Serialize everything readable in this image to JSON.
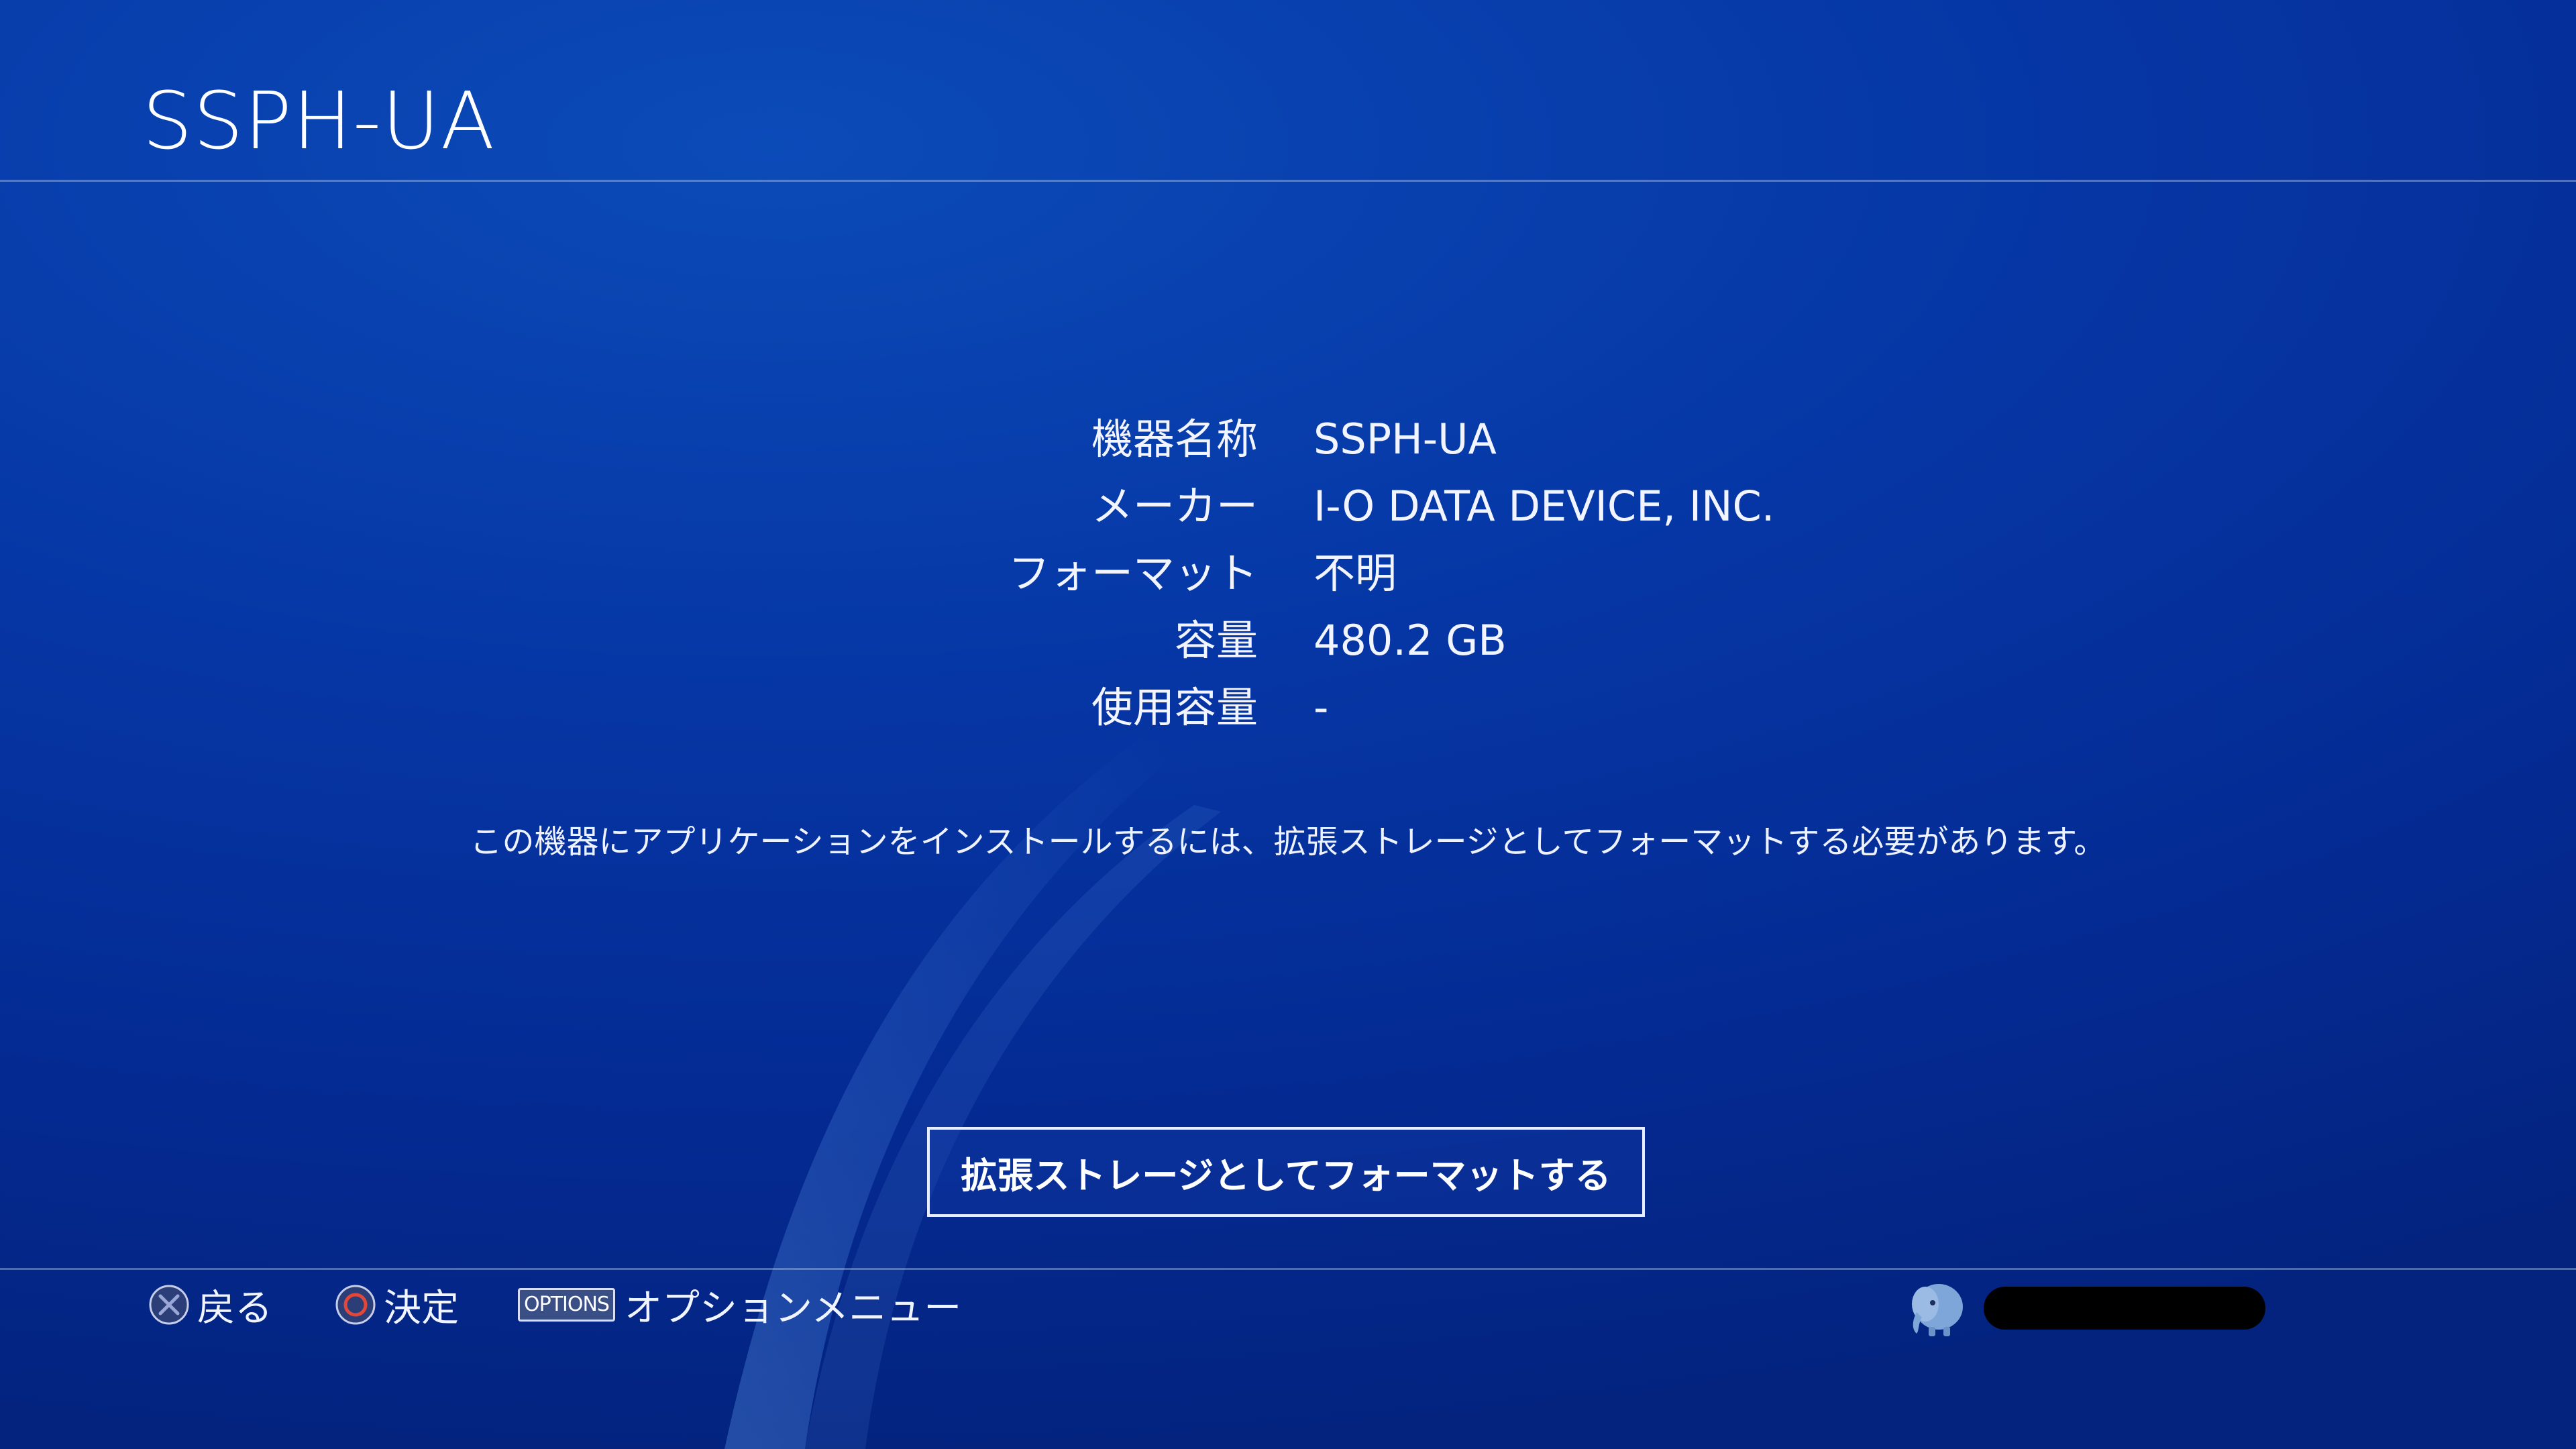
{
  "header": {
    "title": "SSPH-UA"
  },
  "device_info": {
    "rows": [
      {
        "label": "機器名称",
        "value": "SSPH-UA"
      },
      {
        "label": "メーカー",
        "value": "I-O DATA DEVICE, INC."
      },
      {
        "label": "フォーマット",
        "value": "不明"
      },
      {
        "label": "容量",
        "value": "480.2 GB"
      },
      {
        "label": "使用容量",
        "value": "-"
      }
    ]
  },
  "note": "この機器にアプリケーションをインストールするには、拡張ストレージとしてフォーマットする必要があります。",
  "actions": {
    "format_button_label": "拡張ストレージとしてフォーマットする"
  },
  "footer": {
    "hints": [
      {
        "icon": "cross-button-icon",
        "label": "戻る"
      },
      {
        "icon": "circle-button-icon",
        "label": "決定"
      },
      {
        "icon": "options-button-icon",
        "badge": "OPTIONS",
        "label": "オプションメニュー"
      }
    ],
    "user": {
      "avatar_icon": "elephant-avatar-icon"
    }
  },
  "colors": {
    "background": "#0637a6",
    "cross_glyph": "#9aa7d6",
    "circle_glyph": "#e2483a"
  }
}
